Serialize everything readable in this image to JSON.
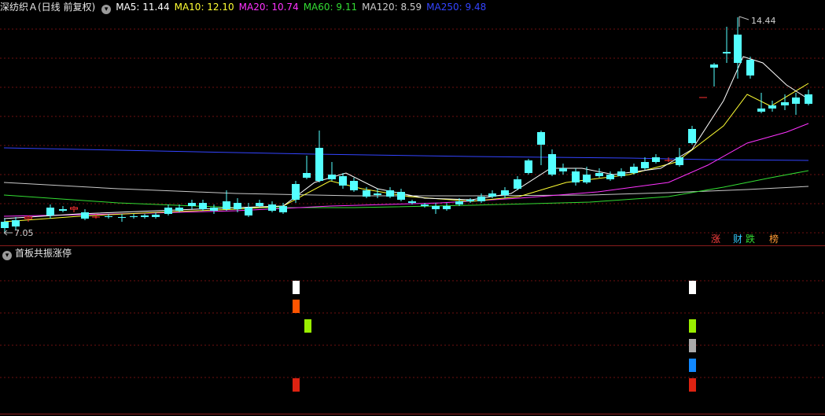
{
  "header": {
    "title": "深纺织Ａ(日线 前复权)",
    "ma": [
      {
        "label": "MA5: 11.44",
        "color": "#ffffff"
      },
      {
        "label": "MA10: 12.10",
        "color": "#ffff33"
      },
      {
        "label": "MA20: 10.74",
        "color": "#ff33ff"
      },
      {
        "label": "MA60: 9.11",
        "color": "#33dd33"
      },
      {
        "label": "MA120: 8.59",
        "color": "#cccccc"
      },
      {
        "label": "MA250: 9.48",
        "color": "#3344ff"
      }
    ]
  },
  "price_labels": {
    "high": "14.44",
    "low": "7.05"
  },
  "badges": [
    {
      "text": "涨",
      "color": "#ff4040"
    },
    {
      "text": "财",
      "color": "#33ccff"
    },
    {
      "text": "跌",
      "color": "#33dd33"
    },
    {
      "text": "榜",
      "color": "#ff9933"
    }
  ],
  "indicator": {
    "title": "首板共振涨停"
  },
  "colors": {
    "up": "#ff3232",
    "down": "#54ffff",
    "grid": "#7a1414",
    "background": "#000000"
  }
}
